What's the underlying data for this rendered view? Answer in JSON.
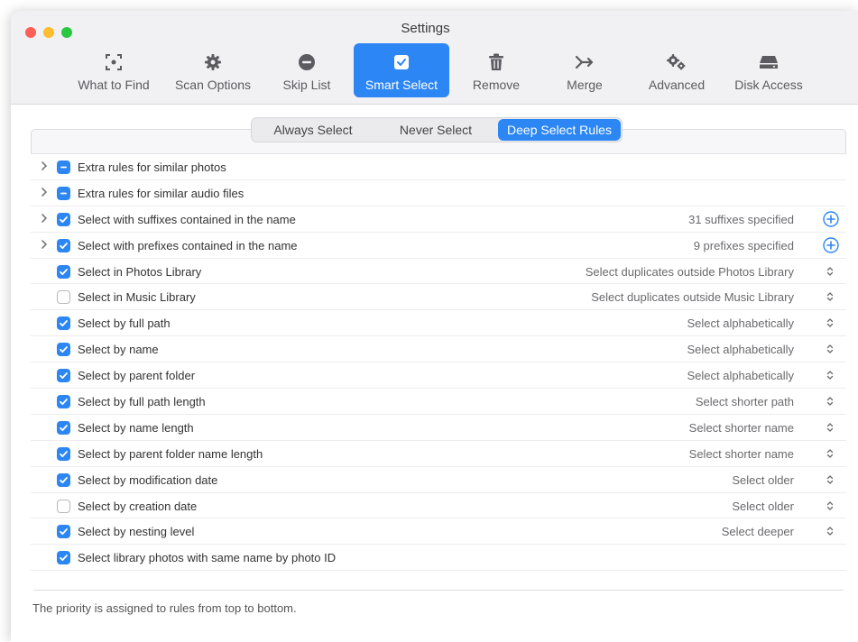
{
  "window": {
    "title": "Settings"
  },
  "toolbar": {
    "items": [
      {
        "label": "What to Find",
        "icon": "viewfinder-icon",
        "active": false
      },
      {
        "label": "Scan Options",
        "icon": "gear-icon",
        "active": false
      },
      {
        "label": "Skip List",
        "icon": "minus-circle-icon",
        "active": false
      },
      {
        "label": "Smart Select",
        "icon": "checkbox-icon",
        "active": true
      },
      {
        "label": "Remove",
        "icon": "trash-icon",
        "active": false
      },
      {
        "label": "Merge",
        "icon": "merge-arrow-icon",
        "active": false
      },
      {
        "label": "Advanced",
        "icon": "gears-icon",
        "active": false
      },
      {
        "label": "Disk Access",
        "icon": "disk-icon",
        "active": false
      }
    ]
  },
  "segmented": {
    "items": [
      "Always Select",
      "Never Select",
      "Deep Select Rules"
    ],
    "selected": "Deep Select Rules"
  },
  "rules": [
    {
      "label": "Extra rules for similar photos",
      "state": "mixed",
      "expandable": true,
      "value": "",
      "control": "none"
    },
    {
      "label": "Extra rules for similar audio files",
      "state": "mixed",
      "expandable": true,
      "value": "",
      "control": "none"
    },
    {
      "label": "Select with suffixes contained in the name",
      "state": "checked",
      "expandable": true,
      "value": "31 suffixes specified",
      "control": "add"
    },
    {
      "label": "Select with prefixes contained in the name",
      "state": "checked",
      "expandable": true,
      "value": "9 prefixes specified",
      "control": "add"
    },
    {
      "label": "Select in Photos Library",
      "state": "checked",
      "expandable": false,
      "value": "Select duplicates outside Photos Library",
      "control": "popup"
    },
    {
      "label": "Select in Music Library",
      "state": "unchecked",
      "expandable": false,
      "value": "Select duplicates outside Music Library",
      "control": "popup"
    },
    {
      "label": "Select by full path",
      "state": "checked",
      "expandable": false,
      "value": "Select alphabetically",
      "control": "popup"
    },
    {
      "label": "Select by name",
      "state": "checked",
      "expandable": false,
      "value": "Select alphabetically",
      "control": "popup"
    },
    {
      "label": "Select by parent folder",
      "state": "checked",
      "expandable": false,
      "value": "Select alphabetically",
      "control": "popup"
    },
    {
      "label": "Select by full path length",
      "state": "checked",
      "expandable": false,
      "value": "Select shorter path",
      "control": "popup"
    },
    {
      "label": "Select by name length",
      "state": "checked",
      "expandable": false,
      "value": "Select shorter name",
      "control": "popup"
    },
    {
      "label": "Select by parent folder name length",
      "state": "checked",
      "expandable": false,
      "value": "Select shorter name",
      "control": "popup"
    },
    {
      "label": "Select by modification date",
      "state": "checked",
      "expandable": false,
      "value": "Select older",
      "control": "popup"
    },
    {
      "label": "Select by creation date",
      "state": "unchecked",
      "expandable": false,
      "value": "Select older",
      "control": "popup"
    },
    {
      "label": "Select by nesting level",
      "state": "checked",
      "expandable": false,
      "value": "Select deeper",
      "control": "popup"
    },
    {
      "label": "Select library photos with same name by photo ID",
      "state": "checked",
      "expandable": false,
      "value": "",
      "control": "none"
    }
  ],
  "footer": {
    "note": "The priority is assigned to rules from top to bottom."
  },
  "colors": {
    "accent": "#2c86f3",
    "toolbar_bg": "#f1f1f4"
  }
}
